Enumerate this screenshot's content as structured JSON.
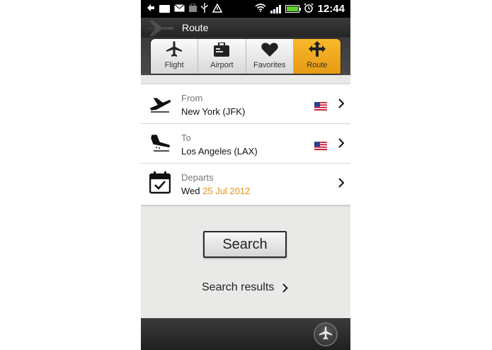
{
  "status_bar": {
    "time": "12:44"
  },
  "header": {
    "title": "Route"
  },
  "tabs": [
    {
      "label": "Flight",
      "icon": "airplane-icon",
      "active": false
    },
    {
      "label": "Airport",
      "icon": "suitcase-icon",
      "active": false
    },
    {
      "label": "Favorites",
      "icon": "heart-icon",
      "active": false
    },
    {
      "label": "Route",
      "icon": "route-arrows-icon",
      "active": true
    }
  ],
  "route": {
    "from": {
      "label": "From",
      "value": "New York (JFK)",
      "icon": "departure-plane-icon",
      "flag": "us-flag-icon"
    },
    "to": {
      "label": "To",
      "value": "Los Angeles (LAX)",
      "icon": "arrival-plane-icon",
      "flag": "us-flag-icon"
    },
    "departs": {
      "label": "Departs",
      "day": "Wed",
      "date": "25 Jul 2012",
      "icon": "calendar-icon"
    }
  },
  "actions": {
    "search_label": "Search",
    "results_label": "Search results"
  },
  "colors": {
    "accent": "#f0a21c",
    "date_accent": "#e8901a",
    "dark_bar": "#2b2b2b"
  }
}
